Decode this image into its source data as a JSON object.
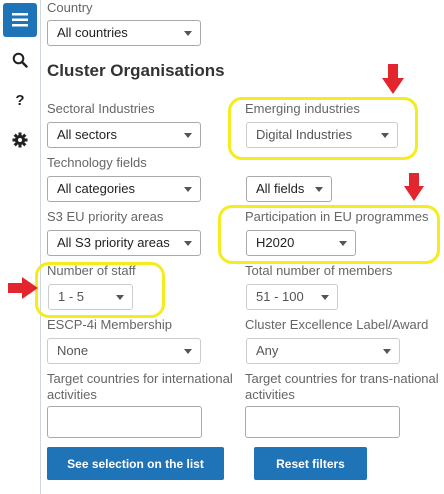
{
  "sidebar": {
    "menu_icon": "hamburger-icon",
    "items": [
      {
        "icon": "search-icon"
      },
      {
        "icon": "help-icon",
        "glyph": "?"
      },
      {
        "icon": "gear-icon"
      }
    ]
  },
  "country": {
    "label": "Country",
    "value": "All countries"
  },
  "heading": "Cluster Organisations",
  "sectoral": {
    "label": "Sectoral Industries",
    "value": "All sectors"
  },
  "emerging": {
    "label": "Emerging industries",
    "value": "Digital Industries"
  },
  "tech": {
    "label": "Technology fields",
    "value": "All categories"
  },
  "tech_sub": {
    "value": "All fields"
  },
  "s3": {
    "label": "S3 EU priority areas",
    "value": "All S3 priority areas"
  },
  "participation": {
    "label": "Participation in EU programmes",
    "value": "H2020"
  },
  "staff": {
    "label": "Number of staff",
    "value": "1 - 5"
  },
  "members": {
    "label": "Total number of members",
    "value": "51 - 100"
  },
  "escp": {
    "label": "ESCP-4i Membership",
    "value": "None"
  },
  "excellence": {
    "label": "Cluster Excellence Label/Award",
    "value": "Any"
  },
  "target_intl": {
    "label_line1": "Target countries for international",
    "label_line2": "activities",
    "value": ""
  },
  "target_trans": {
    "label_line1": "Target countries for trans-national",
    "label_line2": "activities",
    "value": ""
  },
  "buttons": {
    "see_selection": "See selection on the list",
    "reset": "Reset filters"
  },
  "colors": {
    "accent": "#1f73b7",
    "highlight": "#f4ec1d",
    "annotation_arrow": "#e3262d"
  }
}
